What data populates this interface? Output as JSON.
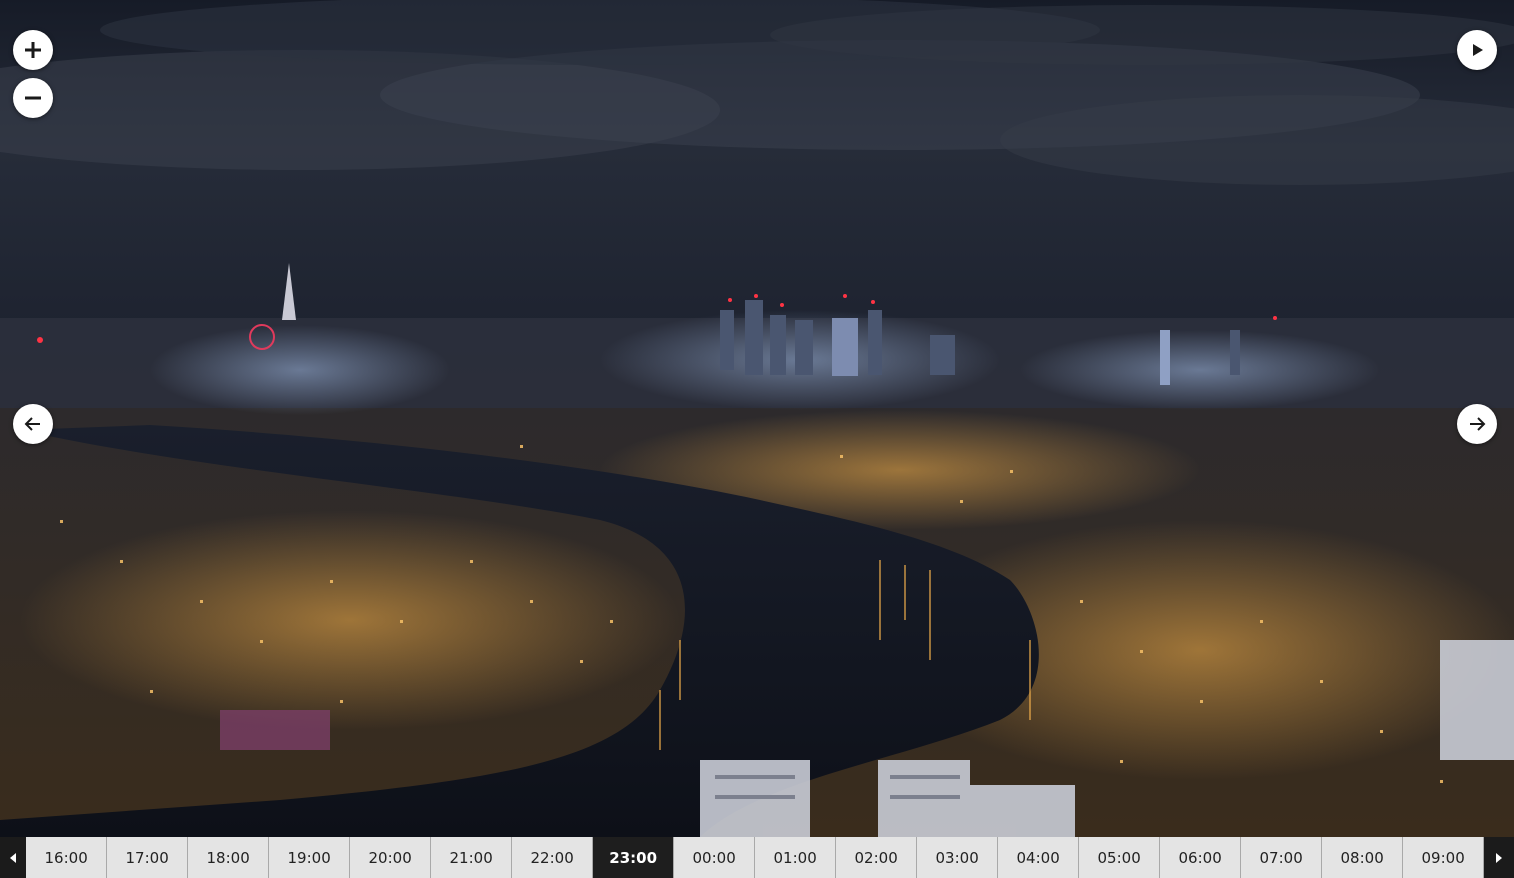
{
  "viewer": {
    "controls": {
      "zoom_in": "plus-icon",
      "zoom_out": "minus-icon",
      "play": "play-icon",
      "previous": "arrow-left-icon",
      "next": "arrow-right-icon"
    }
  },
  "timeline": {
    "active_index": 7,
    "slots": [
      "16:00",
      "17:00",
      "18:00",
      "19:00",
      "20:00",
      "21:00",
      "22:00",
      "23:00",
      "00:00",
      "01:00",
      "02:00",
      "03:00",
      "04:00",
      "05:00",
      "06:00",
      "07:00",
      "08:00",
      "09:00"
    ],
    "left_arrow": "caret-left-icon",
    "right_arrow": "caret-right-icon"
  },
  "colors": {
    "sky": "#1f2533",
    "water": "#121620",
    "city_light": "#f2a640",
    "timeline_bg": "#e4e4e4",
    "timeline_active": "#1e1e1e"
  }
}
